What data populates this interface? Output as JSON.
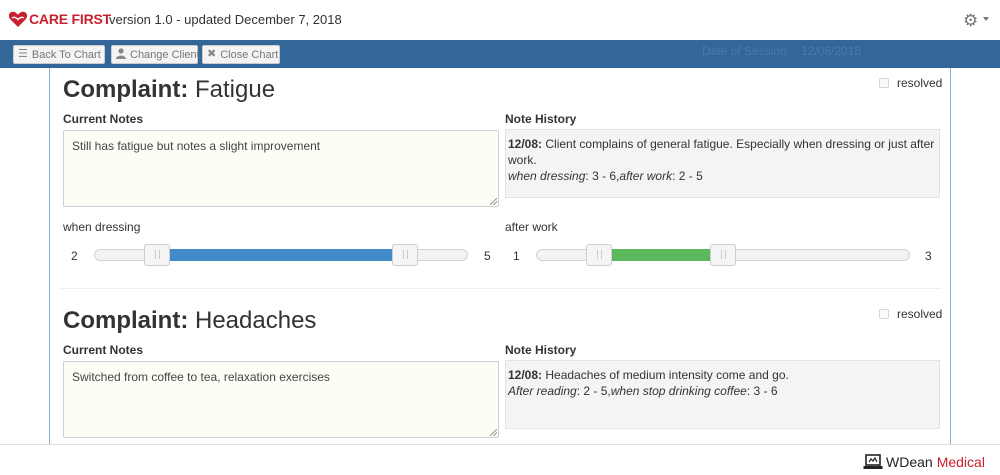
{
  "header": {
    "brand": "CARE FIRST",
    "version_text": "version 1.0 - updated December 7, 2018"
  },
  "toolbar": {
    "back_label": "Back To Chart",
    "change_client_label": "Change Client",
    "close_chart_label": "Close Chart",
    "session_label": "Date of Session",
    "session_date": "12/08/2018"
  },
  "complaints": [
    {
      "label": "Complaint:",
      "name": "Fatigue",
      "resolved_label": "resolved",
      "resolved": false,
      "current_notes_label": "Current Notes",
      "current_notes": "Still has fatigue but notes a slight improvement",
      "history_label": "Note History",
      "history_date": "12/08:",
      "history_text": "Client complains of general fatigue. Especially when dressing or just after work.",
      "history_ratings": [
        {
          "name": "when dressing",
          "value": "3 - 6",
          "sep": ","
        },
        {
          "name": "after work",
          "value": "2 - 5",
          "sep": ""
        }
      ],
      "sliders": [
        {
          "label": "when dressing",
          "low": 2,
          "high": 5,
          "min_label": "2",
          "max_label": "5",
          "range_color": "#428bca"
        },
        {
          "label": "after work",
          "low": 1,
          "high": 2,
          "min_label": "1",
          "max_label": "3",
          "range_color": "#5cb85c"
        }
      ]
    },
    {
      "label": "Complaint:",
      "name": "Headaches",
      "resolved_label": "resolved",
      "resolved": false,
      "current_notes_label": "Current Notes",
      "current_notes": "Switched from coffee to tea, relaxation exercises",
      "history_label": "Note History",
      "history_date": "12/08:",
      "history_text": "Headaches of medium intensity come and go.",
      "history_ratings": [
        {
          "name": "After reading",
          "value": "2 - 5",
          "sep": ","
        },
        {
          "name": "when stop drinking coffee",
          "value": "3 - 6",
          "sep": ""
        }
      ]
    }
  ],
  "footer": {
    "company_w": "WDean",
    "company_m": "Medical"
  },
  "colors": {
    "brand_red": "#c8202f",
    "toolbar_blue": "#336699"
  },
  "icons": {
    "brand": "heart-hands-icon",
    "settings": "gear-icon",
    "back": "list-icon",
    "change_client": "user-icon",
    "close": "close-icon",
    "footer": "laptop-icon"
  }
}
